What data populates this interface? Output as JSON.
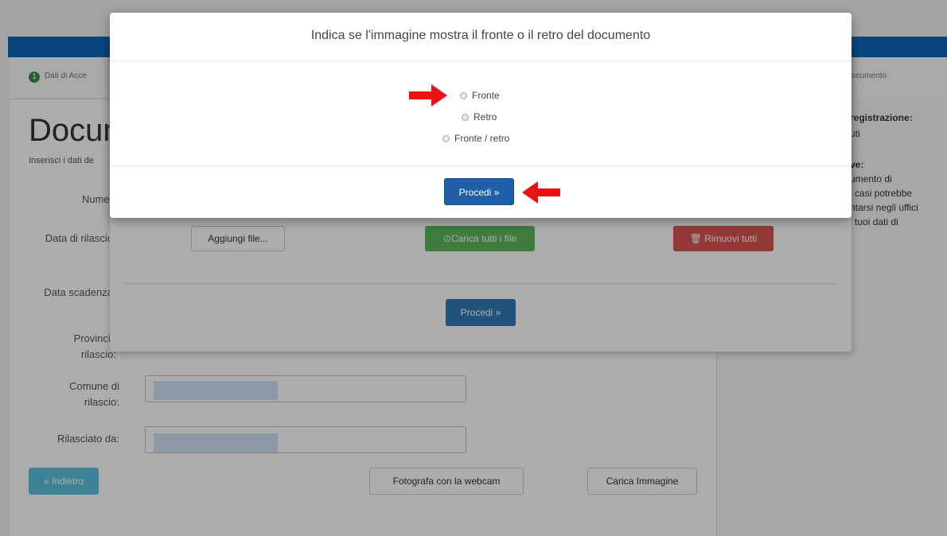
{
  "background_page": {
    "step_number": "1",
    "step_label": "Dati di Acce",
    "step_last_label": "ocumento",
    "title": "Docum",
    "subtitle": "Inserisci i dati de",
    "fields": [
      {
        "label": "Numer"
      },
      {
        "label": "Data di rilascio"
      },
      {
        "label": "Data scadenza"
      },
      {
        "label": "Provincia\nrilascio:"
      },
      {
        "label": "Comune di\nrilascio:"
      },
      {
        "label": "Rilasciato da:"
      }
    ],
    "buttons": {
      "back": "« Indietro",
      "webcam": "Fotografa con la webcam",
      "upload_image": "Carica Immagine"
    },
    "right_panel": {
      "line1": "registrazione:",
      "line2": "uti",
      "line3": "ve:",
      "line4": "umento di",
      "line5": "i casi potrebbe",
      "line6": "ntarsi negli uffici",
      "line7": "i tuoi dati di"
    }
  },
  "underlying_dialog": {
    "add_file": "Aggiungi file...",
    "upload_all": "Carica tutti i file",
    "remove_all": "Rimuovi tutti",
    "proceed": "Procedi »"
  },
  "modal": {
    "title": "Indica se l'immagine mostra il fronte o il retro del documento",
    "options": [
      {
        "label": "Fronte",
        "selected": false
      },
      {
        "label": "Retro",
        "selected": false
      },
      {
        "label": "Fronte / retro",
        "selected": false
      }
    ],
    "proceed": "Procedi »"
  },
  "colors": {
    "accent_blue": "#0e66b8",
    "proceed_blue": "#1f5fa8",
    "success_green": "#5cb85c",
    "danger_red": "#d9534f",
    "info_cyan": "#5bc0de",
    "annotation_red": "#ee1111"
  }
}
